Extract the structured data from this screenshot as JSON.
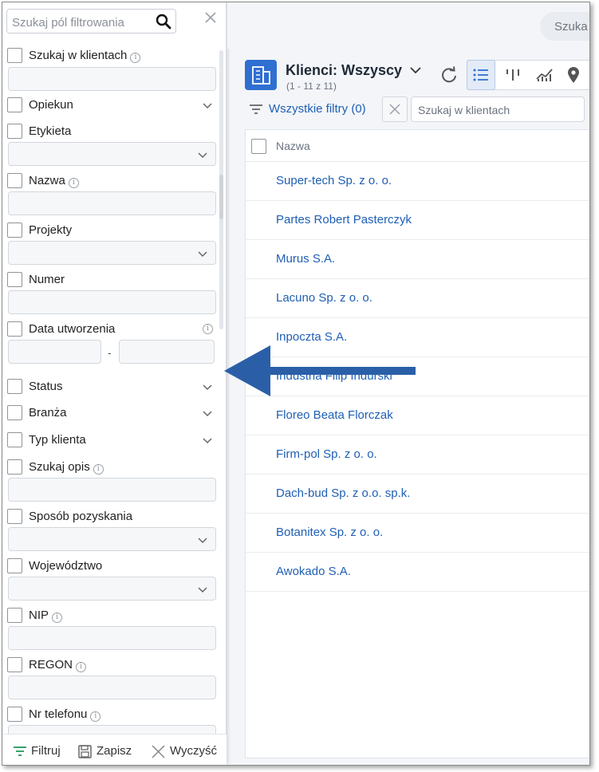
{
  "filter_panel": {
    "search_placeholder": "Szukaj pól filtrowania",
    "items": [
      {
        "label": "Szukaj w klientach",
        "info": true,
        "control": "input"
      },
      {
        "label": "Opiekun",
        "info": false,
        "control": "collapse"
      },
      {
        "label": "Etykieta",
        "info": false,
        "control": "select"
      },
      {
        "label": "Nazwa",
        "info": true,
        "control": "input"
      },
      {
        "label": "Projekty",
        "info": false,
        "control": "select"
      },
      {
        "label": "Numer",
        "info": false,
        "control": "input"
      },
      {
        "label": "Data utworzenia",
        "info": true,
        "control": "range",
        "range_separator": "-"
      },
      {
        "label": "Status",
        "info": false,
        "control": "collapse"
      },
      {
        "label": "Branża",
        "info": false,
        "control": "collapse"
      },
      {
        "label": "Typ klienta",
        "info": false,
        "control": "collapse"
      },
      {
        "label": "Szukaj opis",
        "info": true,
        "control": "input"
      },
      {
        "label": "Sposób pozyskania",
        "info": false,
        "control": "select"
      },
      {
        "label": "Województwo",
        "info": false,
        "control": "select"
      },
      {
        "label": "NIP",
        "info": true,
        "control": "input"
      },
      {
        "label": "REGON",
        "info": true,
        "control": "input"
      },
      {
        "label": "Nr telefonu",
        "info": true,
        "control": "input"
      }
    ],
    "footer": {
      "filter": "Filtruj",
      "save": "Zapisz",
      "clear": "Wyczyść"
    }
  },
  "topbar": {
    "search_label": "Szuka"
  },
  "view": {
    "title": "Klienci: Wszyscy",
    "subtitle": "(1 - 11 z 11)",
    "all_filters": "Wszystkie filtry (0)",
    "search_placeholder": "Szukaj w klientach"
  },
  "table": {
    "header": "Nazwa",
    "rows": [
      "Super-tech Sp. z o. o.",
      "Partes Robert Pasterczyk",
      "Murus S.A.",
      "Lacuno Sp. z o. o.",
      "Inpoczta S.A.",
      "Industria Filip Indurski",
      "Floreo Beata Florczak",
      "Firm-pol Sp. z o. o.",
      "Dach-bud Sp. z o.o. sp.k.",
      "Botanitex Sp. z o. o.",
      "Awokado S.A."
    ]
  },
  "colors": {
    "accent": "#1f5fb4",
    "brand": "#2f6fd1",
    "arrow": "#2a5fa8"
  },
  "icons": [
    "search-icon",
    "close-icon",
    "info-icon",
    "chevron-down-icon",
    "refresh-icon",
    "list-view-icon",
    "kanban-view-icon",
    "chart-view-icon",
    "map-pin-icon",
    "building-icon",
    "filter-icon",
    "save-icon",
    "clear-icon"
  ]
}
